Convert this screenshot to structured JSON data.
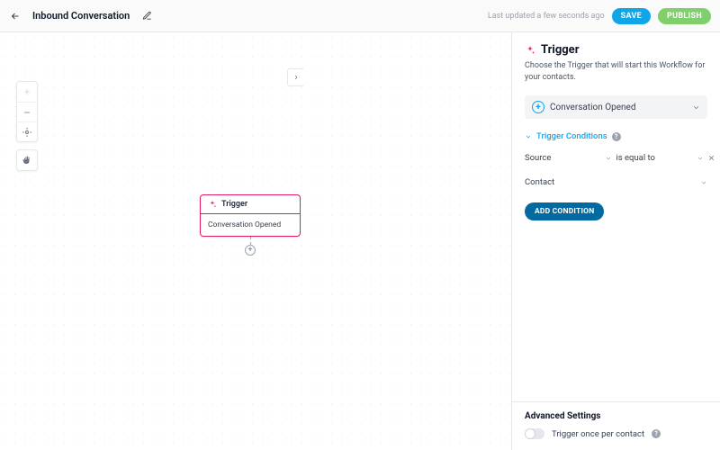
{
  "header": {
    "title": "Inbound Conversation",
    "last_updated": "Last updated a few seconds ago",
    "save": "SAVE",
    "publish": "PUBLISH"
  },
  "canvas": {
    "node": {
      "title": "Trigger",
      "body": "Conversation Opened"
    }
  },
  "panel": {
    "title": "Trigger",
    "description": "Choose the Trigger that will start this Workflow for your contacts.",
    "trigger_selected": "Conversation Opened",
    "conditions_label": "Trigger Conditions",
    "condition_rows": {
      "source": {
        "field": "Source",
        "operator": "is equal to"
      },
      "contact": {
        "field": "Contact"
      }
    },
    "add_condition": "ADD CONDITION",
    "advanced": {
      "heading": "Advanced Settings",
      "once_per_contact": "Trigger once per contact"
    }
  }
}
